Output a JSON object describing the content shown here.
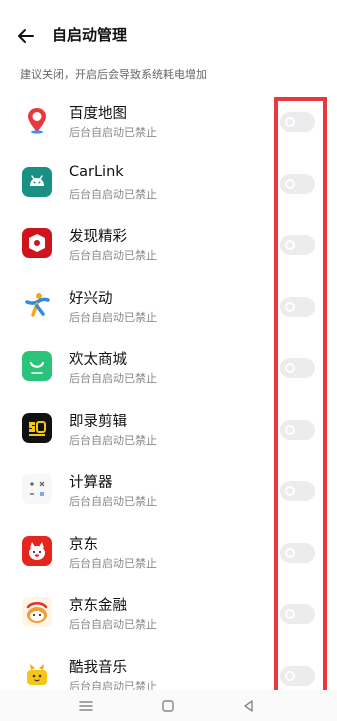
{
  "header": {
    "title": "自启动管理"
  },
  "subtitle": "建议关闭，开启后会导致系统耗电增加",
  "apps": [
    {
      "name": "百度地图",
      "status": "后台自启动已禁止",
      "icon": "baidu-maps-icon",
      "enabled": false
    },
    {
      "name": "CarLink",
      "status": "后台自启动已禁止",
      "icon": "carlink-icon",
      "enabled": false
    },
    {
      "name": "发现精彩",
      "status": "后台自启动已禁止",
      "icon": "faxian-jingcai-icon",
      "enabled": false
    },
    {
      "name": "好兴动",
      "status": "后台自启动已禁止",
      "icon": "haoxingdong-icon",
      "enabled": false
    },
    {
      "name": "欢太商城",
      "status": "后台自启动已禁止",
      "icon": "huantai-mall-icon",
      "enabled": false
    },
    {
      "name": "即录剪辑",
      "status": "后台自启动已禁止",
      "icon": "jilu-editor-icon",
      "enabled": false
    },
    {
      "name": "计算器",
      "status": "后台自启动已禁止",
      "icon": "calculator-icon",
      "enabled": false
    },
    {
      "name": "京东",
      "status": "后台自启动已禁止",
      "icon": "jd-icon",
      "enabled": false
    },
    {
      "name": "京东金融",
      "status": "后台自启动已禁止",
      "icon": "jd-finance-icon",
      "enabled": false
    },
    {
      "name": "酷我音乐",
      "status": "后台自启动已禁止",
      "icon": "kuwo-music-icon",
      "enabled": false
    }
  ],
  "colors": {
    "highlight": "#e8383d",
    "toggle_off": "#ececec"
  },
  "navbar": {
    "icons": [
      "menu-icon",
      "home-icon",
      "back-triangle-icon"
    ]
  }
}
